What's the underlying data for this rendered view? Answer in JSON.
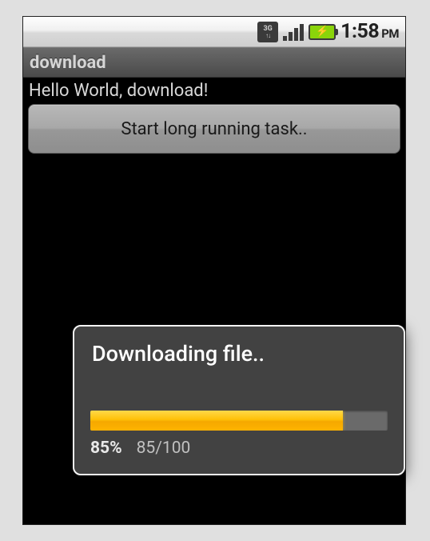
{
  "statusbar": {
    "network_label": "3G",
    "time": "1:58",
    "ampm": "PM"
  },
  "titlebar": {
    "title": "download"
  },
  "content": {
    "hello_text": "Hello World, download!",
    "button_label": "Start long running task.."
  },
  "dialog": {
    "title": "Downloading file..",
    "percent_label": "85%",
    "count_label": "85/100",
    "percent_value": 85
  }
}
